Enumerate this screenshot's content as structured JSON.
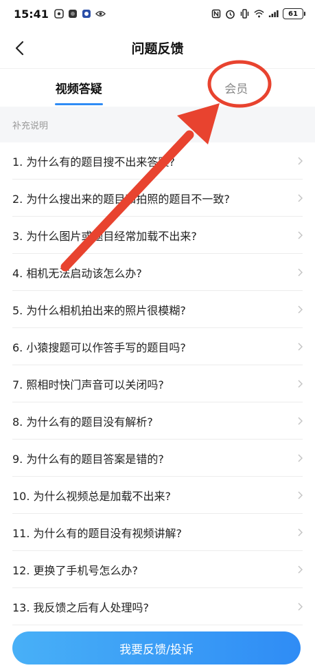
{
  "status_bar": {
    "time": "15:41",
    "battery": "61"
  },
  "nav": {
    "title": "问题反馈"
  },
  "tabs": [
    {
      "label": "视频答疑",
      "active": true
    },
    {
      "label": "会员",
      "active": false
    }
  ],
  "section": {
    "label": "补充说明"
  },
  "faq_items": [
    "1. 为什么有的题目搜不出来答案?",
    "2. 为什么搜出来的题目和拍照的题目不一致?",
    "3. 为什么图片或题目经常加载不出来?",
    "4. 相机无法启动该怎么办?",
    "5. 为什么相机拍出来的照片很模糊?",
    "6. 小猿搜题可以作答手写的题目吗?",
    "7. 照相时快门声音可以关闭吗?",
    "8. 为什么有的题目没有解析?",
    "9. 为什么有的题目答案是错的?",
    "10. 为什么视频总是加载不出来?",
    "11. 为什么有的题目没有视频讲解?",
    "12. 更换了手机号怎么办?",
    "13. 我反馈之后有人处理吗?"
  ],
  "footer": {
    "button_label": "我要反馈/投诉"
  },
  "colors": {
    "accent": "#2f8cf5",
    "annotation": "#e8432f"
  }
}
